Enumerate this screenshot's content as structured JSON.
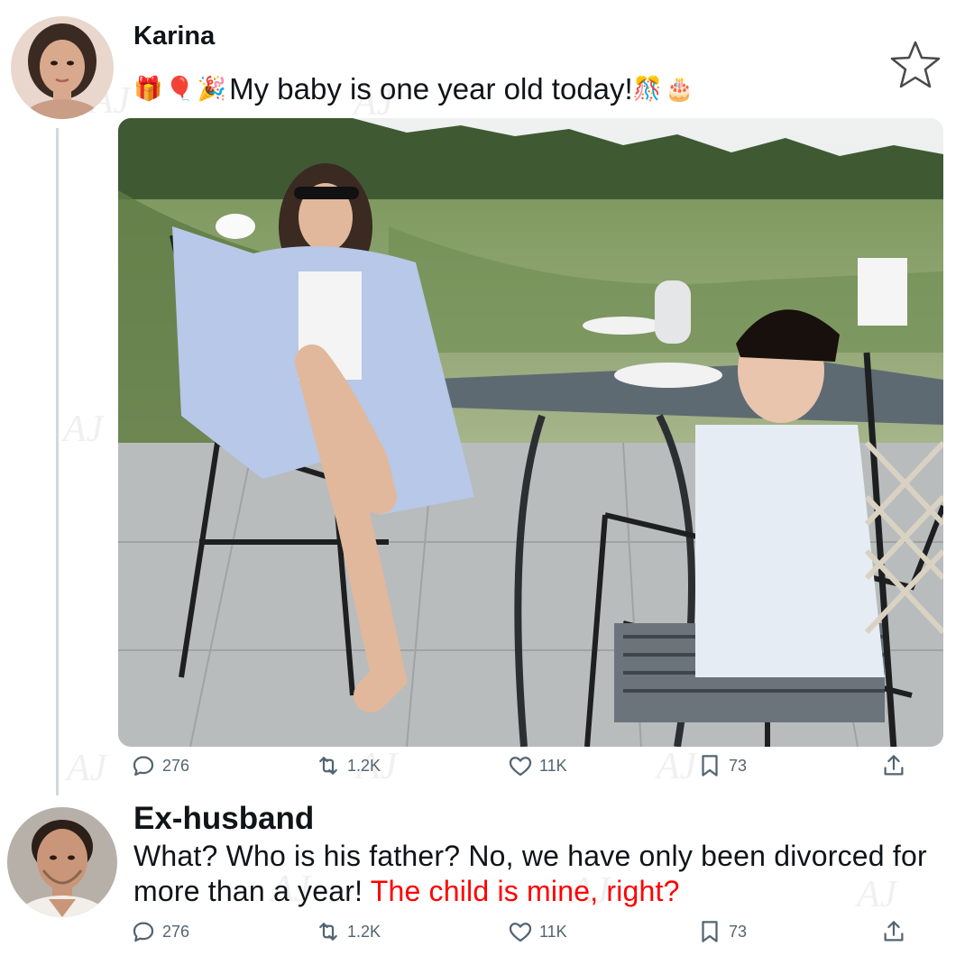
{
  "post": {
    "author": "Karina",
    "emojis_before": [
      "🎁",
      "🎈",
      "🎉"
    ],
    "text": "My baby is one year old today!",
    "emojis_after": [
      "🎊",
      "🎂"
    ],
    "image": {
      "alt": "woman and boy at outdoor table",
      "icon": "photo"
    },
    "stats": {
      "replies": "276",
      "retweets": "1.2K",
      "likes": "11K",
      "bookmarks": "73"
    }
  },
  "reply": {
    "author": "Ex-husband",
    "text_main": "What? Who is his father? No, we have only been divorced for more than a year! ",
    "text_highlight": "The child is mine, right?",
    "highlight_color": "#ff0000",
    "stats": {
      "replies": "276",
      "retweets": "1.2K",
      "likes": "11K",
      "bookmarks": "73"
    }
  },
  "watermark": "AJ",
  "colors": {
    "icon": "#536471",
    "thread_line": "#cfd9de",
    "text": "#0f1419"
  }
}
